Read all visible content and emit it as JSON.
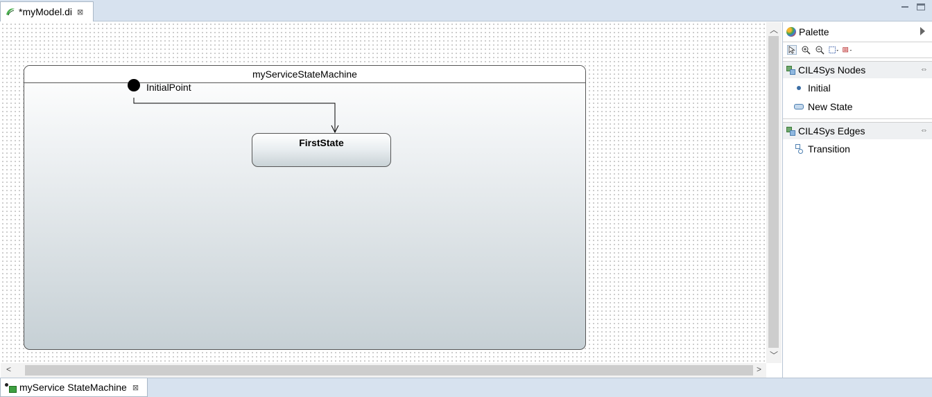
{
  "editor": {
    "tab_title": "*myModel.di",
    "close_glyph": "⊠"
  },
  "diagram": {
    "state_machine_name": "myServiceStateMachine",
    "initial_point_label": "InitialPoint",
    "state_name": "FirstState"
  },
  "palette": {
    "title": "Palette",
    "tools": [
      "select-tool",
      "zoom-in-tool",
      "zoom-out-tool",
      "marquee-tool",
      "note-tool"
    ],
    "drawers": [
      {
        "label": "CIL4Sys Nodes",
        "entries": [
          {
            "label": "Initial",
            "icon": "initial-node-icon"
          },
          {
            "label": "New State",
            "icon": "state-node-icon"
          }
        ]
      },
      {
        "label": "CIL4Sys Edges",
        "entries": [
          {
            "label": "Transition",
            "icon": "transition-icon"
          }
        ]
      }
    ]
  },
  "bottom": {
    "tab_title": "myService StateMachine",
    "close_glyph": "⊠"
  },
  "colors": {
    "tab_bar": "#d7e2ef",
    "state_gradient_bottom": "#c6d0d5"
  }
}
